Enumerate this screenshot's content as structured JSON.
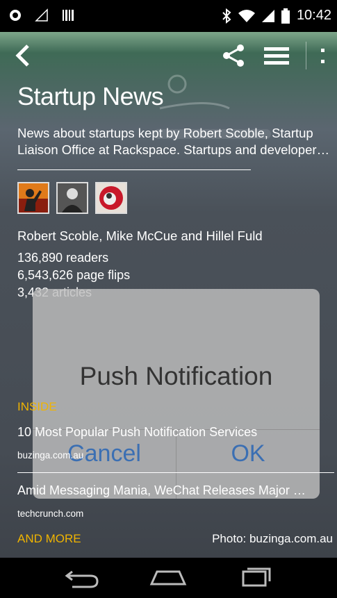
{
  "status_bar": {
    "time": "10:42",
    "icons": [
      "settings-icon",
      "signal-off-icon",
      "barcode-icon",
      "bluetooth-icon",
      "wifi-icon",
      "cell-signal-icon",
      "battery-icon"
    ]
  },
  "toolbar": {
    "icons": [
      "back-arrow-icon",
      "share-icon",
      "menu-icon",
      "overflow-icon"
    ]
  },
  "magazine": {
    "title": "Startup News",
    "description_line1": "News about startups kept by Robert Scoble, Startup",
    "description_line2": "Liaison Office at Rackspace. Startups and developers …",
    "curators": "Robert Scoble, Mike McCue and Hillel Fuld",
    "readers": "136,890 readers",
    "page_flips": "6,543,626 page flips",
    "articles": "3,432 articles"
  },
  "dialog": {
    "title": "Push Notification",
    "cancel_label": "Cancel",
    "ok_label": "OK"
  },
  "inside": {
    "label": "INSIDE",
    "items": [
      {
        "title": "10 Most Popular Push Notification Services",
        "source": "buzinga.com.au"
      },
      {
        "title": "Amid Messaging Mania, WeChat Releases Major …",
        "source": "techcrunch.com"
      }
    ],
    "and_more": "AND MORE",
    "photo_credit": "Photo: buzinga.com.au"
  },
  "colors": {
    "accent": "#f0b400",
    "dialog_button": "#3b6fb3"
  }
}
